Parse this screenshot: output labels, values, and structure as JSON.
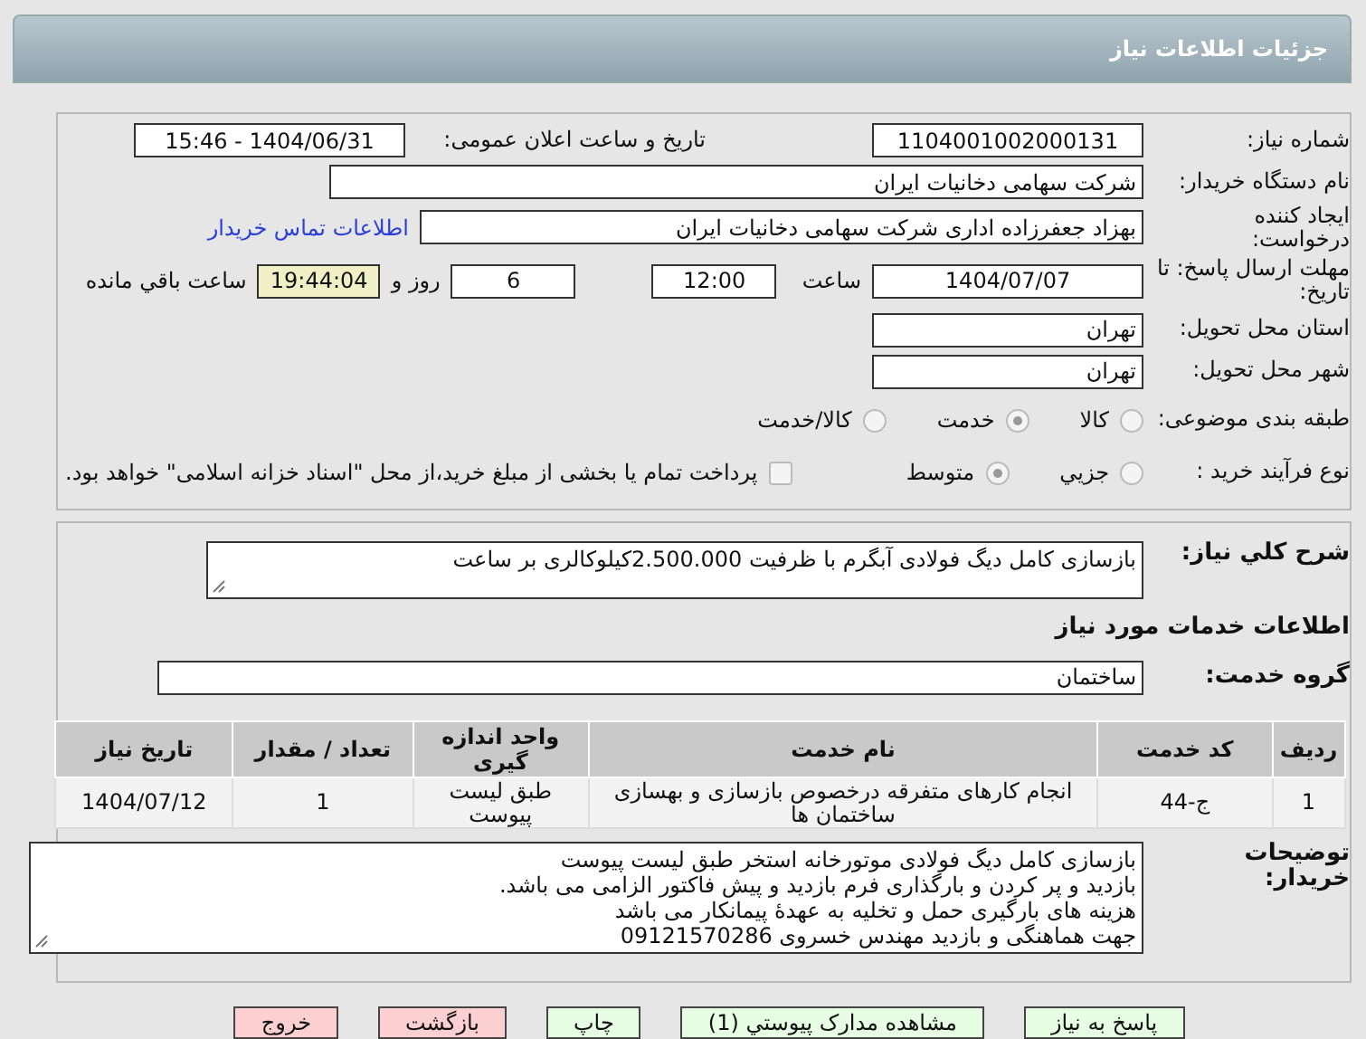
{
  "title": "جزئیات اطلاعات نیاز",
  "need_number": {
    "label": "شماره نیاز:",
    "value": "1104001002000131"
  },
  "announce": {
    "label": "تاریخ و ساعت اعلان عمومی:",
    "value": "1404/06/31 - 15:46"
  },
  "buyer": {
    "label": "نام دستگاه خریدار:",
    "value": "شرکت سهامی دخانیات ایران"
  },
  "creator": {
    "label": "ایجاد کننده درخواست:",
    "value": "بهزاد جعفرزاده اداری شرکت سهامی دخانیات ایران",
    "link": "اطلاعات تماس خریدار"
  },
  "deadline": {
    "label": "مهلت ارسال پاسخ: تا تاریخ:",
    "date": "1404/07/07",
    "time_label": "ساعت",
    "time": "12:00",
    "days": "6",
    "days_label": "روز و",
    "remaining": "19:44:04",
    "remaining_label": "ساعت باقي مانده"
  },
  "province": {
    "label": "استان محل تحویل:",
    "value": "تهران"
  },
  "city": {
    "label": "شهر محل تحویل:",
    "value": "تهران"
  },
  "category": {
    "label": "طبقه بندی موضوعی:",
    "options": [
      {
        "label": "کالا",
        "selected": false
      },
      {
        "label": "خدمت",
        "selected": true
      },
      {
        "label": "کالا/خدمت",
        "selected": false
      }
    ]
  },
  "process": {
    "label": "نوع فرآیند خرید :",
    "options": [
      {
        "label": "جزیي",
        "selected": false
      },
      {
        "label": "متوسط",
        "selected": true
      }
    ],
    "payment": {
      "checked": false,
      "text": "پرداخت تمام یا بخشی از مبلغ خرید،از محل \"اسناد خزانه اسلامی\" خواهد بود."
    }
  },
  "summary": {
    "label": "شرح کلي نیاز:",
    "value": "بازسازی کامل دیگ فولادی آبگرم با ظرفیت 2.500.000کیلوکالری بر ساعت"
  },
  "services_heading": "اطلاعات خدمات مورد نیاز",
  "service_group": {
    "label": "گروه خدمت:",
    "value": "ساختمان"
  },
  "table": {
    "columns": [
      "ردیف",
      "کد خدمت",
      "نام خدمت",
      "واحد اندازه گیری",
      "تعداد / مقدار",
      "تاریخ نیاز"
    ],
    "rows": [
      [
        "1",
        "ج-44",
        "انجام کارهای متفرقه درخصوص بازسازی و بهسازی ساختمان ها",
        "طبق لیست پیوست",
        "1",
        "1404/07/12"
      ]
    ]
  },
  "notes": {
    "label": "توضیحات خریدار:",
    "value": "بازسازی کامل دیگ فولادی موتورخانه استخر طبق لیست پیوست\nبازدید و پر کردن و بارگذاری فرم بازدید و پیش فاکتور الزامی می باشد.\nهزینه های بارگیری حمل و تخلیه به عهدۀ پیمانکار می باشد\nجهت هماهنگی و بازدید مهندس خسروی 09121570286"
  },
  "buttons": [
    {
      "label": "پاسخ به نیاز",
      "kind": "go"
    },
    {
      "label": "مشاهده مدارک پیوستي (1)",
      "kind": "go"
    },
    {
      "label": "چاپ",
      "kind": "go"
    },
    {
      "label": "بازگشت",
      "kind": "stop"
    },
    {
      "label": "خروج",
      "kind": "stop"
    }
  ]
}
